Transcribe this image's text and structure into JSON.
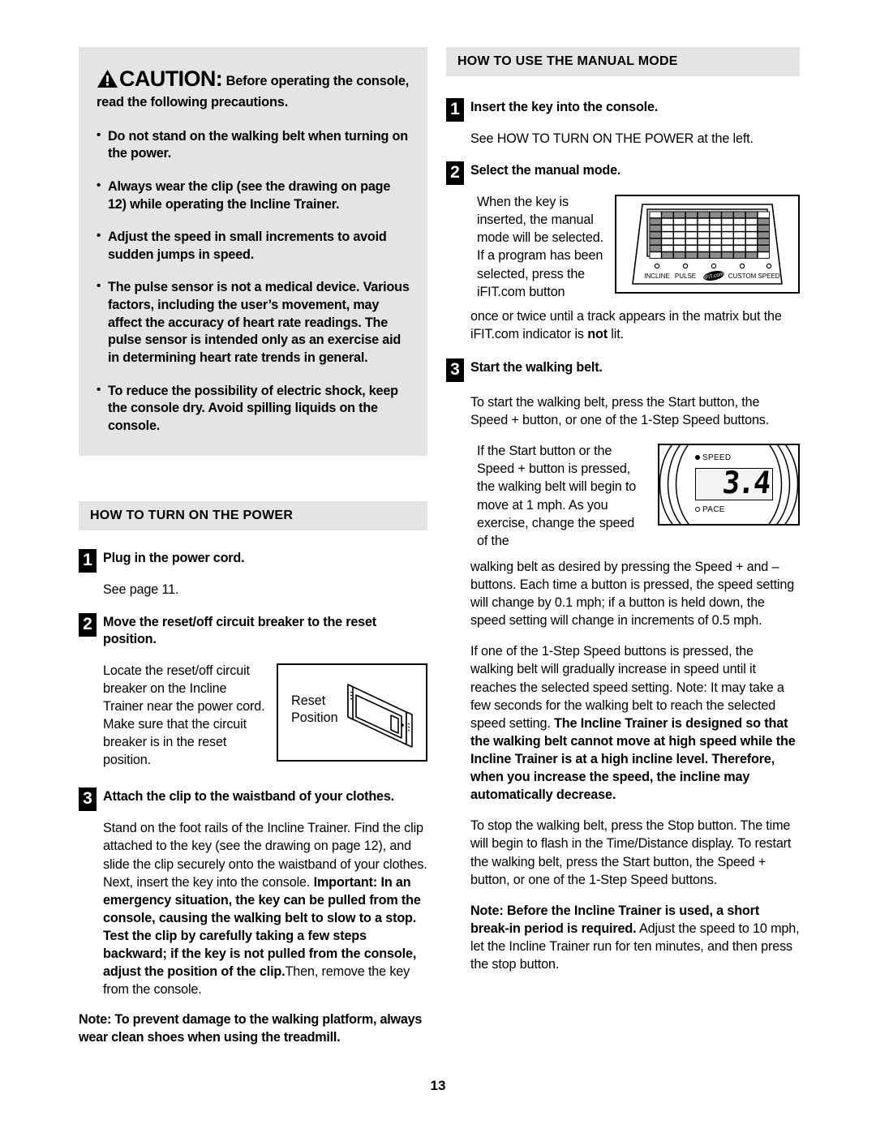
{
  "page": {
    "number": "13"
  },
  "caution": {
    "icon": "warning-triangle-icon",
    "word": "CAUTION",
    "colon": ":",
    "headline": "Before operating the console, read the following precautions.",
    "bullets": [
      "Do not stand on the walking belt when turning on the power.",
      "Always wear the clip (see the drawing on page 12) while operating the Incline Trainer.",
      "Adjust the speed in small increments to avoid sudden jumps in speed.",
      "The pulse sensor is not a medical device. Various factors, including the user’s movement, may affect the accuracy of heart rate readings. The pulse sensor is intended only as an exercise aid in determining heart rate trends in general.",
      "To reduce the possibility of electric shock, keep the console dry. Avoid spilling liquids on the console."
    ]
  },
  "power_section": {
    "heading": "HOW TO TURN ON THE POWER",
    "steps": [
      {
        "num": "1",
        "title": "Plug in the power cord.",
        "body": "See page 11."
      },
      {
        "num": "2",
        "title": "Move the reset/off circuit breaker to the reset position.",
        "body": "Locate the reset/off circuit breaker on the Incline Trainer near the power cord. Make sure that the circuit breaker is in the reset position."
      },
      {
        "num": "3",
        "title": "Attach the clip to the waistband of your clothes.",
        "body_plain_1": "Stand on the foot rails of the Incline Trainer. Find the clip attached to the key (see the drawing on page 12), and slide the clip securely onto the waistband of your clothes. Next, insert the key into the console. ",
        "body_bold_1": "Important: In an emergency situation, the key can be pulled from the console, causing the walking belt to slow to a stop. Test the clip by carefully taking a few steps backward; if the key is not pulled from the console, adjust the position of the clip.",
        "body_plain_2": "Then, remove the key from the console."
      }
    ],
    "reset_figure": {
      "label_line1": "Reset",
      "label_line2": "Position",
      "art": "circuit-breaker-switch-drawing"
    },
    "note": "Note: To prevent damage to the walking platform, always wear clean shoes when using the treadmill."
  },
  "manual_section": {
    "heading": "HOW TO USE THE MANUAL MODE",
    "steps": [
      {
        "num": "1",
        "title": "Insert the key into the console.",
        "body": "See HOW TO TURN ON THE POWER at the left."
      },
      {
        "num": "2",
        "title": "Select the manual mode.",
        "body_wrap": "When the key is inserted, the manual mode will be selected. If a program has been selected, press the iFIT.com button",
        "body_after_plain_1": "once or twice until a track appears in the matrix but the iFIT.com indicator is ",
        "body_after_bold": "not",
        "body_after_plain_2": " lit."
      },
      {
        "num": "3",
        "title": "Start the walking belt.",
        "para1": "To start the walking belt, press the Start button, the Speed + button, or one of the 1-Step Speed buttons.",
        "para2_wrap": "If the Start button or the Speed + button is pressed, the walking belt will begin to move at 1 mph. As you exercise, change the speed of the",
        "para2_rest": "walking belt as desired by pressing the Speed + and – buttons. Each time a button is pressed, the speed setting will change by 0.1 mph; if a button is held down, the speed setting will change in increments of 0.5 mph.",
        "para3_plain_1": "If one of the 1-Step Speed buttons is pressed, the walking belt will gradually increase in speed until it reaches the selected speed setting. Note: It may take a few seconds for the walking belt to reach the selected speed setting. ",
        "para3_bold": "The Incline Trainer is designed so that the walking belt cannot move at high speed while the Incline Trainer is at a high incline level. Therefore, when you increase the speed, the incline may automatically decrease.",
        "para4": "To stop the walking belt, press the Stop button. The time will begin to flash in the Time/Distance display. To restart the walking belt, press the Start button, the Speed + button, or one of the 1-Step Speed buttons.",
        "para5_bold": "Note: Before the Incline Trainer is used, a short break-in period is required.",
        "para5_plain": " Adjust the speed to 10 mph, let the Incline Trainer run for ten minutes, and then press the stop button."
      }
    ],
    "console_figure": {
      "art": "console-matrix-drawing",
      "indicators": [
        "INCLINE",
        "PULSE",
        "iFIT.com",
        "CUSTOM",
        "SPEED"
      ]
    },
    "speed_figure": {
      "art": "speed-display-drawing",
      "speed_label": "SPEED",
      "pace_label": "PACE",
      "value": "3.4"
    }
  },
  "colors": {
    "gray_panel": "#e4e4e4",
    "ink": "#000000",
    "lcd_bg": "#f3f3f3",
    "matrix_gray": "#8c8c8c"
  }
}
